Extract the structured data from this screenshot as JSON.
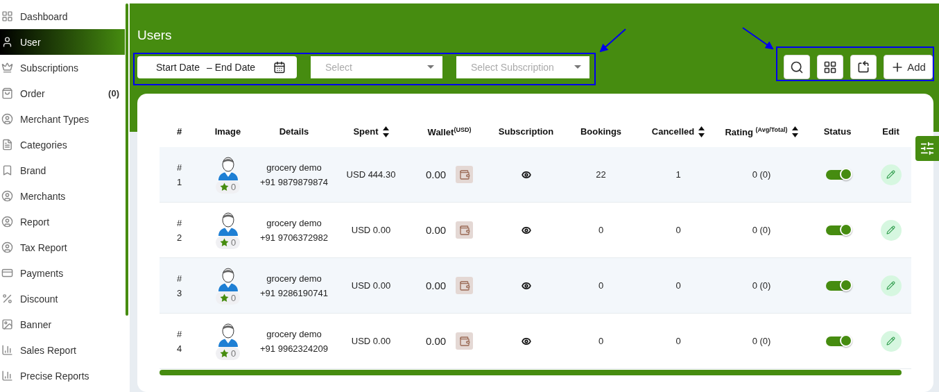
{
  "sidebar": {
    "items": [
      {
        "label": "Dashboard",
        "selected": false
      },
      {
        "label": "User",
        "selected": true
      },
      {
        "label": "Subscriptions",
        "selected": false
      },
      {
        "label": "Order",
        "selected": false,
        "count": "(0)"
      },
      {
        "label": "Merchant Types",
        "selected": false
      },
      {
        "label": "Categories",
        "selected": false
      },
      {
        "label": "Brand",
        "selected": false
      },
      {
        "label": "Merchants",
        "selected": false
      },
      {
        "label": "Report",
        "selected": false
      },
      {
        "label": "Tax Report",
        "selected": false
      },
      {
        "label": "Payments",
        "selected": false
      },
      {
        "label": "Discount",
        "selected": false
      },
      {
        "label": "Banner",
        "selected": false
      },
      {
        "label": "Sales Report",
        "selected": false
      },
      {
        "label": "Precise Reports",
        "selected": false
      }
    ]
  },
  "header": {
    "title": "Users"
  },
  "filters": {
    "date_range": {
      "start": "Start Date",
      "separator": "–",
      "end": "End Date"
    },
    "selects": [
      {
        "placeholder": "Select"
      },
      {
        "placeholder": "Select Subscription"
      }
    ]
  },
  "toolbar": [
    {
      "kind": "search"
    },
    {
      "kind": "grid"
    },
    {
      "kind": "export"
    },
    {
      "kind": "add",
      "label": "Add"
    }
  ],
  "table": {
    "columns": [
      {
        "label": "#",
        "sortable": false
      },
      {
        "label": "Image",
        "sortable": false
      },
      {
        "label": "Details",
        "sortable": false
      },
      {
        "label": "Spent",
        "sortable": true
      },
      {
        "label": "Wallet$^{(USD)}$",
        "sortable": false
      },
      {
        "label": "Subscription",
        "sortable": false
      },
      {
        "label": "Bookings",
        "sortable": false
      },
      {
        "label": "Cancelled",
        "sortable": true
      },
      {
        "label": "Rating $^{(Avg/Total)}$",
        "sortable": true
      },
      {
        "label": "Status",
        "sortable": false
      },
      {
        "label": "Edit",
        "sortable": false
      }
    ],
    "rows": [
      {
        "hash": "#",
        "number": "1",
        "rating_badge": "0",
        "name": "grocery demo",
        "phone": "+91 9879879874",
        "spent": "USD 444.30",
        "wallet": "0.00",
        "bookings": "22",
        "cancelled": "1",
        "rating": "0 (0)",
        "status_on": true
      },
      {
        "hash": "#",
        "number": "2",
        "rating_badge": "0",
        "name": "grocery demo",
        "phone": "+91 9706372982",
        "spent": "USD 0.00",
        "wallet": "0.00",
        "bookings": "0",
        "cancelled": "0",
        "rating": "0 (0)",
        "status_on": true
      },
      {
        "hash": "#",
        "number": "3",
        "rating_badge": "0",
        "name": "grocery demo",
        "phone": "+91 9286190741",
        "spent": "USD 0.00",
        "wallet": "0.00",
        "bookings": "0",
        "cancelled": "0",
        "rating": "0 (0)",
        "status_on": true
      },
      {
        "hash": "#",
        "number": "4",
        "rating_badge": "0",
        "name": "grocery demo",
        "phone": "+91 9962324209",
        "spent": "USD 0.00",
        "wallet": "0.00",
        "bookings": "0",
        "cancelled": "0",
        "rating": "0 (0)",
        "status_on": true
      }
    ]
  }
}
